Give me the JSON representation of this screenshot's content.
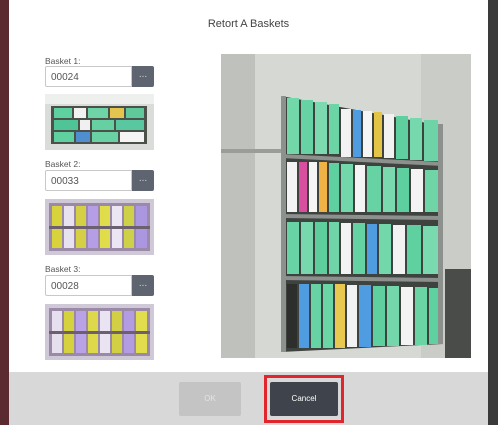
{
  "dialog": {
    "title": "Retort A Baskets"
  },
  "baskets": [
    {
      "label": "Basket 1:",
      "value": "00024",
      "button_label": "..."
    },
    {
      "label": "Basket 2:",
      "value": "00033",
      "button_label": "..."
    },
    {
      "label": "Basket 3:",
      "value": "00028",
      "button_label": "..."
    }
  ],
  "footer": {
    "ok_label": "OK",
    "cancel_label": "Cancel"
  },
  "colors": {
    "highlight": "#e0262c",
    "primary_button": "#3e434c",
    "disabled_button": "#c4c4c4"
  }
}
